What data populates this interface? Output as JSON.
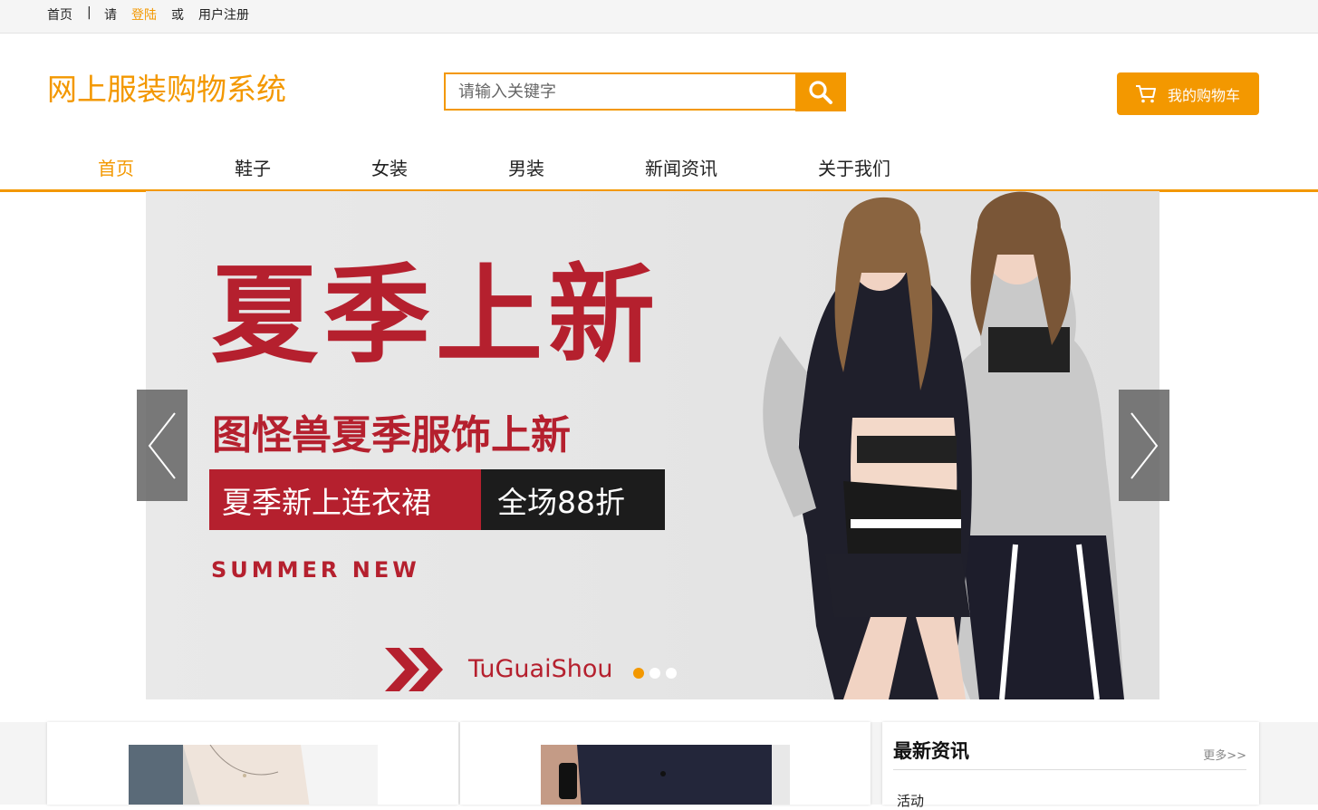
{
  "topbar": {
    "home": "首页",
    "separator": "|",
    "please": "请",
    "login": "登陆",
    "or": "或",
    "register": "用户注册"
  },
  "header": {
    "site_title": "网上服装购物系统",
    "search_placeholder": "请输入关键字",
    "cart_label": "我的购物车"
  },
  "nav": {
    "items": [
      {
        "label": "首页",
        "active": true
      },
      {
        "label": "鞋子",
        "active": false
      },
      {
        "label": "女装",
        "active": false
      },
      {
        "label": "男装",
        "active": false
      },
      {
        "label": "新闻资讯",
        "active": false
      },
      {
        "label": "关于我们",
        "active": false
      }
    ]
  },
  "banner": {
    "headline": "夏季上新",
    "subheadline": "图怪兽夏季服饰上新",
    "tag_red": "夏季新上连衣裙",
    "tag_black": "全场88折",
    "english": "SUMMER NEW",
    "brand": "TuGuaiShou",
    "slide_count": 3,
    "active_slide": 1
  },
  "news": {
    "title": "最新资讯",
    "more": "更多>>",
    "items": [
      "活动"
    ]
  },
  "colors": {
    "accent": "#f39800",
    "banner_red": "#b5202e"
  }
}
